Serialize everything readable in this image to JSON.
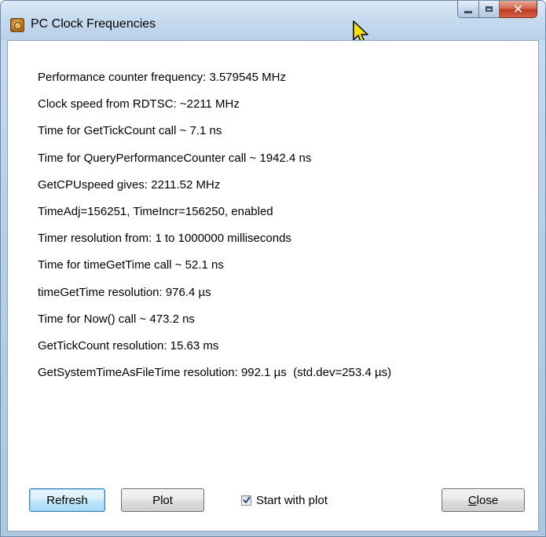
{
  "window": {
    "title": "PC Clock Frequencies",
    "controls": {
      "minimize": "minimize-icon",
      "maximize": "maximize-icon",
      "close": "close-icon"
    }
  },
  "info_lines": [
    "Performance counter frequency: 3.579545 MHz",
    "Clock speed from RDTSC: ~2211 MHz",
    "Time for GetTickCount call ~ 7.1 ns",
    "Time for QueryPerformanceCounter call ~ 1942.4 ns",
    "GetCPUspeed gives: 2211.52 MHz",
    "TimeAdj=156251, TimeIncr=156250, enabled",
    "Timer resolution from: 1 to 1000000 milliseconds",
    "Time for timeGetTime call ~ 52.1 ns",
    "timeGetTime resolution: 976.4 µs",
    "Time for Now() call ~ 473.2 ns",
    "GetTickCount resolution: 15.63 ms",
    "GetSystemTimeAsFileTime resolution: 992.1 µs  (std.dev=253.4 µs)"
  ],
  "buttons": {
    "refresh": "Refresh",
    "plot": "Plot",
    "close_first": "C",
    "close_rest": "lose"
  },
  "checkbox": {
    "label": "Start with plot",
    "checked": true
  },
  "colors": {
    "frame": "#b9d0e8",
    "close_button": "#c03a1e",
    "default_button_border": "#3c7fb1"
  }
}
